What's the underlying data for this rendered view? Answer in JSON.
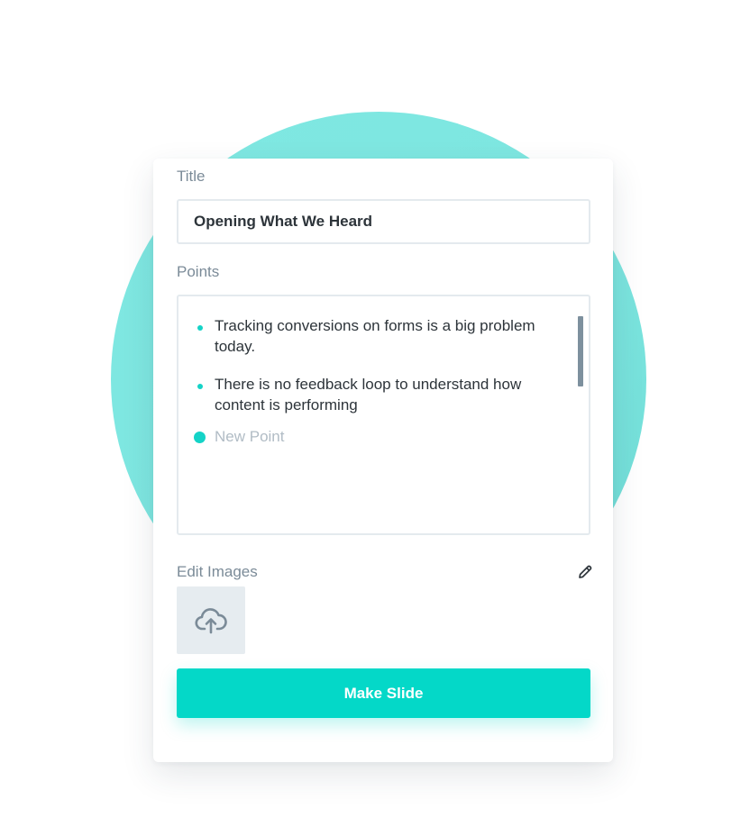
{
  "form": {
    "title_label": "Title",
    "title_value": "Opening What We Heard",
    "points_label": "Points",
    "points": [
      {
        "text": "Tracking conversions on forms is a big problem today."
      },
      {
        "text": "There is no feedback loop to understand how content is performing"
      }
    ],
    "new_point_placeholder": "New Point",
    "images_label": "Edit Images",
    "submit_label": "Make Slide"
  },
  "icons": {
    "edit": "pencil-icon",
    "upload": "cloud-upload-icon"
  },
  "colors": {
    "accent": "#04d8c8",
    "background_circle": "#7ee6e0",
    "label_text": "#7b8b98",
    "body_text": "#2d343a",
    "placeholder_text": "#b1bcc5",
    "tile_background": "#e6ecf0"
  }
}
